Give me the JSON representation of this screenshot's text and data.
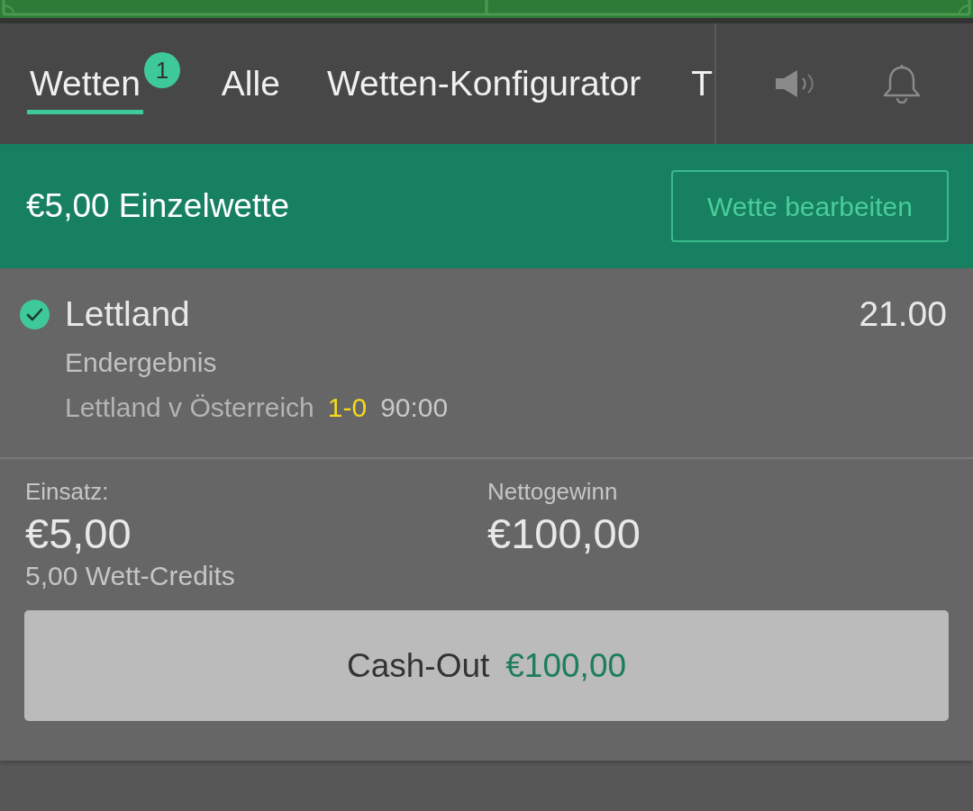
{
  "tabs": [
    {
      "label": "Wetten",
      "selected": true,
      "badge": "1"
    },
    {
      "label": "Alle",
      "selected": false
    },
    {
      "label": "Wetten-Konfigurator",
      "selected": false
    },
    {
      "label": "T",
      "selected": false
    }
  ],
  "bet_header": {
    "title": "€5,00 Einzelwette",
    "button": "Wette bearbeiten"
  },
  "selection": {
    "won": true,
    "name": "Lettland",
    "odds": "21.00",
    "market": "Endergebnis",
    "event": "Lettland v Österreich",
    "score": "1-0",
    "time": "90:00"
  },
  "stake": {
    "label": "Einsatz:",
    "value": "€5,00",
    "credits": "5,00 Wett-Credits"
  },
  "net_win": {
    "label": "Nettogewinn",
    "value": "€100,00"
  },
  "cash_out": {
    "label": "Cash-Out",
    "amount": "€100,00"
  }
}
